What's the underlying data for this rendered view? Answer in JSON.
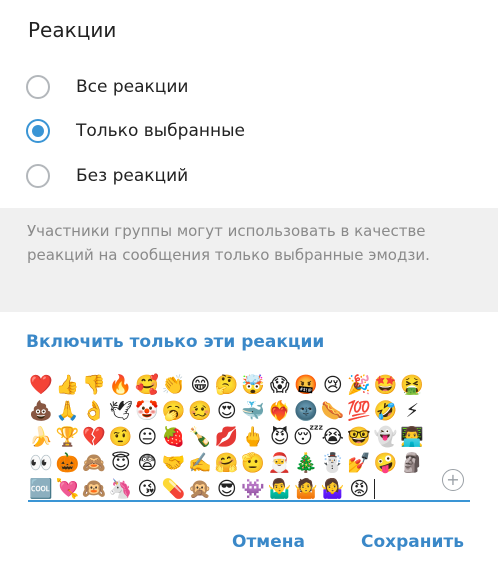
{
  "dialog": {
    "title": "Реакции",
    "options": [
      {
        "label": "Все реакции",
        "checked": false
      },
      {
        "label": "Только выбранные",
        "checked": true
      },
      {
        "label": "Без реакций",
        "checked": false
      }
    ],
    "info_text": "Участники группы могут использовать в качестве реакций на сообщения только выбранные эмодзи.",
    "section_title": "Включить только эти реакции",
    "emoji_rows": [
      [
        "❤️",
        "👍",
        "👎",
        "🔥",
        "🥰",
        "👏",
        "😁",
        "🤔",
        "🤯",
        "😱",
        "🤬",
        "😢",
        "🎉",
        "🤩",
        "🤮"
      ],
      [
        "💩",
        "🙏",
        "👌",
        "🕊",
        "🤡",
        "🥱",
        "🥴",
        "😍",
        "🐳",
        "❤️‍🔥",
        "🌚",
        "🌭",
        "💯",
        "🤣",
        "⚡"
      ],
      [
        "🍌",
        "🏆",
        "💔",
        "🤨",
        "😐",
        "🍓",
        "🍾",
        "💋",
        "🖕",
        "😈",
        "😴",
        "😭",
        "🤓",
        "👻",
        "👨‍💻"
      ],
      [
        "👀",
        "🎃",
        "🙈",
        "😇",
        "😨",
        "🤝",
        "✍️",
        "🤗",
        "🫡",
        "🎅",
        "🎄",
        "☃️",
        "💅",
        "🤪",
        "🗿"
      ],
      [
        "🆒",
        "💘",
        "🙉",
        "🦄",
        "😘",
        "💊",
        "🙊",
        "😎",
        "👾",
        "🤷‍♂️",
        "🤷",
        "🤷‍♀️",
        "😡"
      ]
    ],
    "add_icon": "plus-circle-icon",
    "cancel_label": "Отмена",
    "save_label": "Сохранить",
    "accent_color": "#3a95d5"
  }
}
